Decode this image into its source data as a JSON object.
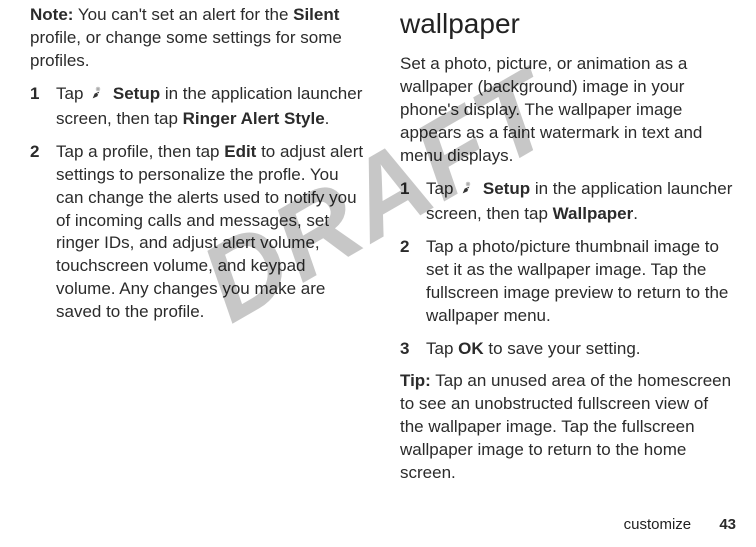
{
  "watermark": "DRAFT",
  "left": {
    "note_label": "Note:",
    "note_a": " You can't set an alert for the ",
    "note_bold": "Silent",
    "note_b": " profile, or change some settings for some profiles.",
    "steps": [
      {
        "num": "1",
        "pre": "Tap ",
        "setup": "Setup",
        "mid": " in the application launcher screen, then tap ",
        "tail_bold": "Ringer Alert Style",
        "post": "."
      },
      {
        "num": "2",
        "pre": "Tap a profile, then tap ",
        "edit": "Edit",
        "mid": " to adjust alert settings to personalize the profle. You can change the alerts used to notify you of incoming calls and messages, set ringer IDs, and adjust alert volume, touchscreen volume, and keypad volume. Any changes you make are saved to the profile."
      }
    ]
  },
  "right": {
    "heading": "wallpaper",
    "intro": "Set a photo, picture, or animation as a wallpaper (background) image in your phone's display. The wallpaper image appears as a faint watermark in text and menu displays.",
    "steps": [
      {
        "num": "1",
        "pre": "Tap ",
        "setup": "Setup",
        "mid": " in the application launcher screen, then tap ",
        "tail_bold": "Wallpaper",
        "post": "."
      },
      {
        "num": "2",
        "text": "Tap a photo/picture thumbnail image to set it as the wallpaper image. Tap the fullscreen image preview to return to the wallpaper menu."
      },
      {
        "num": "3",
        "pre": "Tap ",
        "ok": "OK",
        "post": " to save your setting."
      }
    ],
    "tip_label": "Tip:",
    "tip_text": " Tap an unused area of the homescreen to see an unobstructed fullscreen view of the wallpaper image. Tap the fullscreen wallpaper image to return to the home screen."
  },
  "footer": {
    "section": "customize",
    "page": "43"
  }
}
